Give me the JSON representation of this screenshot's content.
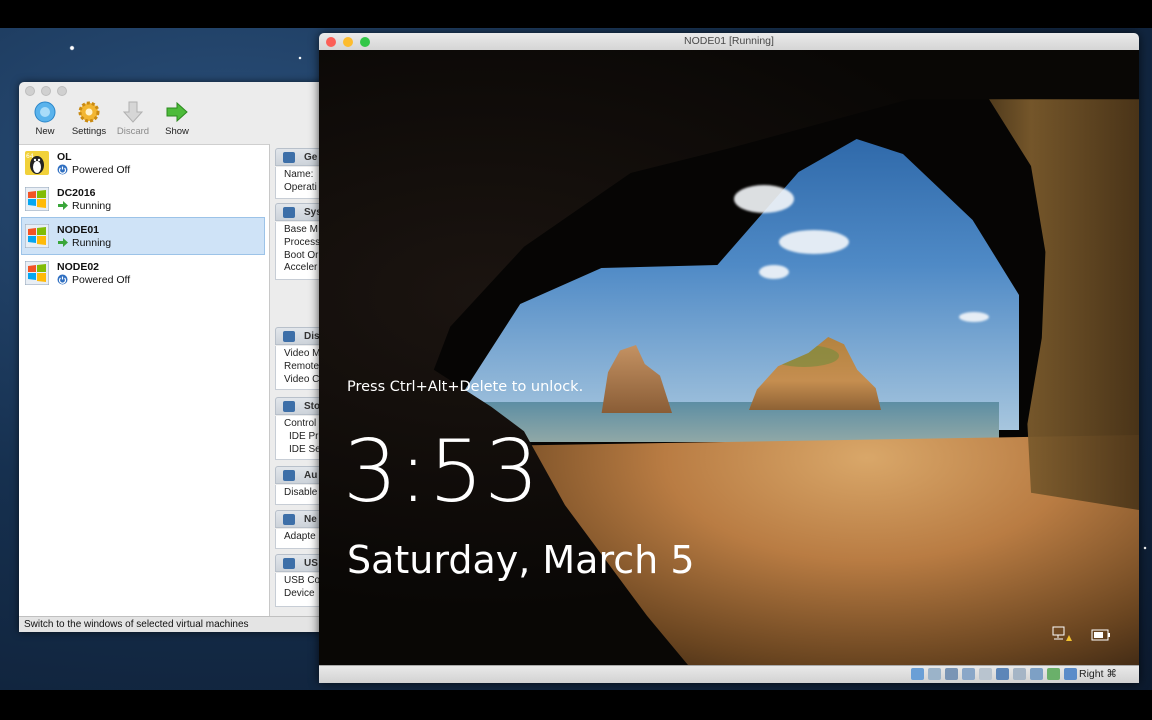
{
  "vbox_manager": {
    "toolbar": {
      "new_label": "New",
      "settings_label": "Settings",
      "discard_label": "Discard",
      "show_label": "Show"
    },
    "vms": [
      {
        "name": "OL",
        "state": "Powered Off"
      },
      {
        "name": "DC2016",
        "state": "Running"
      },
      {
        "name": "NODE01",
        "state": "Running"
      },
      {
        "name": "NODE02",
        "state": "Powered Off"
      }
    ],
    "details": {
      "general_head": "Ge",
      "general_lines": [
        "Name:",
        "Operati"
      ],
      "system_head": "Sys",
      "system_lines": [
        "Base M",
        "Process",
        "Boot Or",
        "Acceler"
      ],
      "display_head": "Dis",
      "display_lines": [
        "Video M",
        "Remote",
        "Video C"
      ],
      "storage_head": "Sto",
      "storage_lines": [
        "Control",
        "IDE Pr",
        "IDE Se"
      ],
      "audio_head": "Au",
      "audio_lines": [
        "Disable"
      ],
      "network_head": "Ne",
      "network_lines": [
        "Adapte"
      ],
      "usb_head": "US",
      "usb_lines": [
        "USB Co",
        "Device"
      ]
    },
    "status_text": "Switch to the windows of selected virtual machines"
  },
  "vm_window": {
    "title": "NODE01 [Running]",
    "lock_screen": {
      "unlock_prompt": "Press Ctrl+Alt+Delete to unlock.",
      "time": "3:53",
      "date": "Saturday, March 5"
    },
    "host_key": "Right ⌘"
  },
  "colors": {
    "traffic_red": "#fc5f57",
    "traffic_yellow": "#fdbc2e",
    "traffic_green": "#33c748",
    "selection": "#cfe3f7",
    "running_arrow": "#3aa63a",
    "powered_off": "#2f6fc1"
  }
}
